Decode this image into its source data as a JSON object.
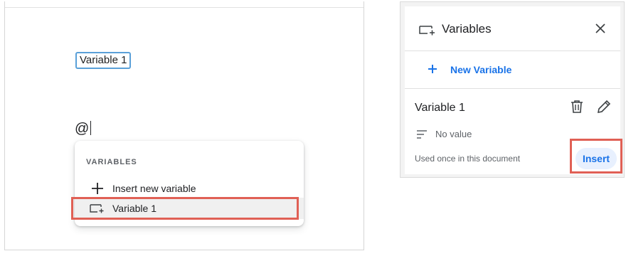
{
  "document": {
    "chip_text": "Variable 1",
    "typed_text": "@",
    "menu": {
      "heading": "VARIABLES",
      "items": [
        {
          "label": "Insert new variable",
          "icon": "plus-icon"
        },
        {
          "label": "Variable 1",
          "icon": "variable-icon"
        }
      ]
    }
  },
  "sidebar": {
    "title": "Variables",
    "title_icon": "variable-icon",
    "close_icon": "close-icon",
    "new_variable_label": "New Variable",
    "variable": {
      "name": "Variable 1",
      "value_text": "No value",
      "usage_text": "Used once in this document",
      "insert_label": "Insert"
    }
  },
  "colors": {
    "accent": "#1a73e8",
    "highlight": "#e06055",
    "chip_border": "#5aa0d8"
  }
}
